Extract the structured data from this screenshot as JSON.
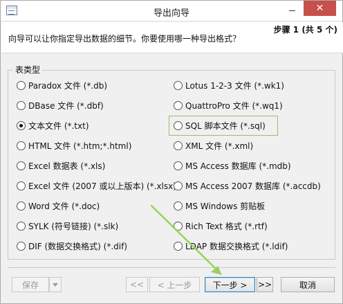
{
  "window": {
    "title": "导出向导",
    "close_glyph": "✕"
  },
  "header": {
    "step": "步骤 1 (共 5 个)",
    "instruction": "向导可以让你指定导出数据的细节。你要使用哪一种导出格式？"
  },
  "group": {
    "label": "表类型"
  },
  "formats_left": [
    {
      "label": "Paradox 文件 (*.db)",
      "checked": false
    },
    {
      "label": "DBase 文件 (*.dbf)",
      "checked": false
    },
    {
      "label": "文本文件 (*.txt)",
      "checked": true
    },
    {
      "label": "HTML 文件 (*.htm;*.html)",
      "checked": false
    },
    {
      "label": "Excel 数据表 (*.xls)",
      "checked": false
    },
    {
      "label": "Excel 文件 (2007 或以上版本) (*.xlsx)",
      "checked": false
    },
    {
      "label": "Word 文件 (*.doc)",
      "checked": false
    },
    {
      "label": "SYLK (符号链接) (*.slk)",
      "checked": false
    },
    {
      "label": "DIF (数据交换格式) (*.dif)",
      "checked": false
    }
  ],
  "formats_right": [
    {
      "label": "Lotus 1-2-3 文件 (*.wk1)",
      "checked": false
    },
    {
      "label": "QuattroPro 文件 (*.wq1)",
      "checked": false
    },
    {
      "label": "SQL 脚本文件 (*.sql)",
      "checked": false
    },
    {
      "label": "XML 文件 (*.xml)",
      "checked": false
    },
    {
      "label": "MS Access 数据库 (*.mdb)",
      "checked": false
    },
    {
      "label": "MS Access 2007 数据库 (*.accdb)",
      "checked": false
    },
    {
      "label": "MS Windows 剪贴板",
      "checked": false
    },
    {
      "label": "Rich Text 格式 (*.rtf)",
      "checked": false
    },
    {
      "label": "LDAP 数据交换格式 (*.ldif)",
      "checked": false
    }
  ],
  "buttons": {
    "save": "保存",
    "first": "<<",
    "prev": "< 上一步",
    "next": "下一步 >",
    "last": ">>",
    "cancel": "取消"
  },
  "colors": {
    "highlight": "#93c461",
    "arrow": "#9ccf5f",
    "close": "#c7504c"
  }
}
